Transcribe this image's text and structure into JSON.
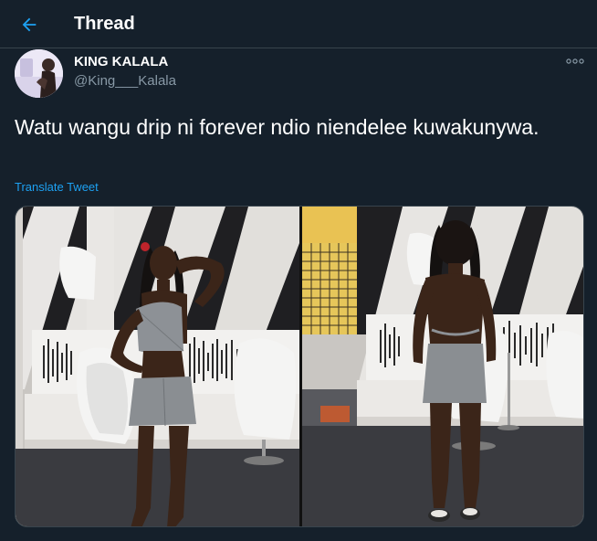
{
  "header": {
    "title": "Thread",
    "back_icon": "arrow-left-icon"
  },
  "tweet": {
    "user_name": "KING KALALA",
    "user_handle": "@King___Kalala",
    "text": "Watu wangu drip ni forever ndio niendelee kuwakunywa.",
    "translate_label": "Translate Tweet",
    "more_icon": "more-dots-icon"
  },
  "media": {
    "count": 2,
    "photos": [
      {
        "description_icon": "photo-front-pose"
      },
      {
        "description_icon": "photo-back-pose"
      }
    ]
  },
  "colors": {
    "background": "#15202b",
    "border": "#38444d",
    "accent": "#1da1f2",
    "secondary_text": "#8899a6"
  }
}
